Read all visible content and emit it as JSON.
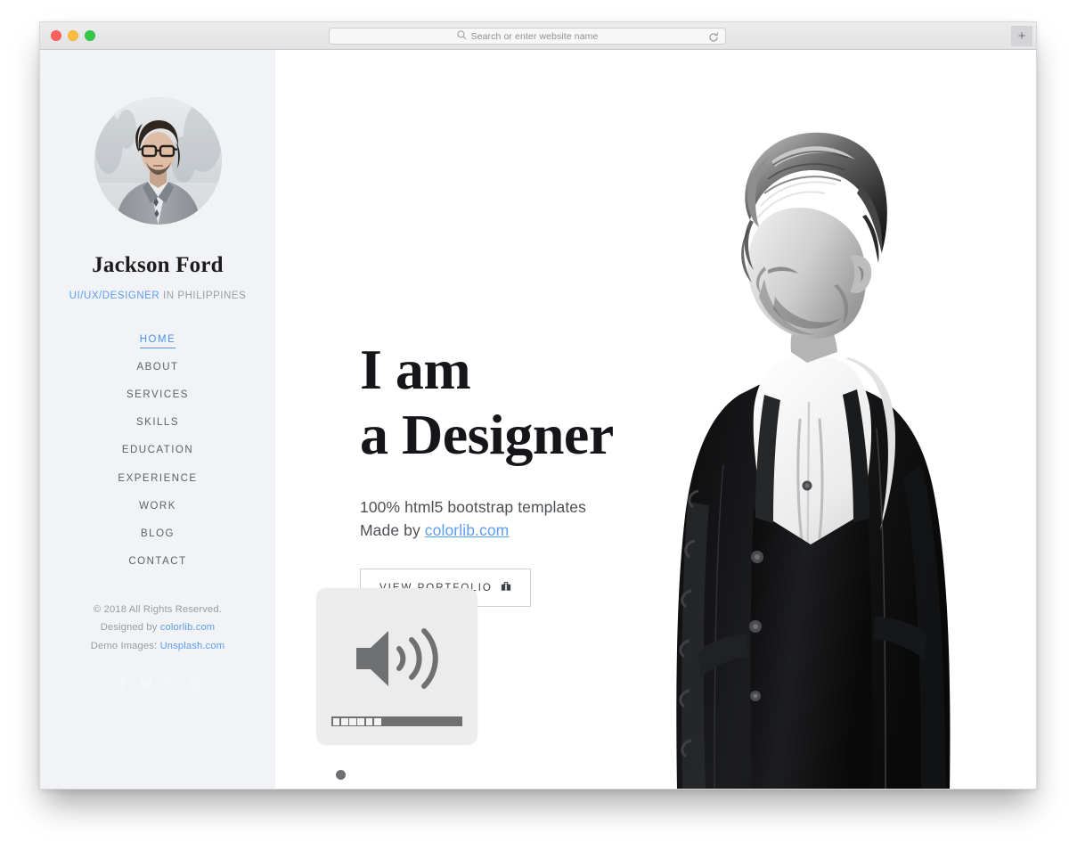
{
  "browser": {
    "traffic_lights": [
      "close",
      "minimize",
      "maximize"
    ],
    "omnibox": {
      "placeholder": "Search or enter website name",
      "value": "",
      "search_icon": "search-icon",
      "reload_icon": "reload-icon"
    },
    "new_tab_label": "+",
    "colors": {
      "titlebar_top": "#ececed",
      "titlebar_bottom": "#e3e3e5",
      "light_red": "#fc615d",
      "light_yellow": "#fdbc40",
      "light_green": "#34c749"
    }
  },
  "sidebar": {
    "avatar_alt": "profile-photo-man-with-glasses-in-gray-blazer",
    "name": "Jackson Ford",
    "role_accent": "UI/UX/DESIGNER",
    "role_rest": " IN PHILIPPINES",
    "nav": [
      {
        "label": "HOME",
        "active": true
      },
      {
        "label": "ABOUT",
        "active": false
      },
      {
        "label": "SERVICES",
        "active": false
      },
      {
        "label": "SKILLS",
        "active": false
      },
      {
        "label": "EDUCATION",
        "active": false
      },
      {
        "label": "EXPERIENCE",
        "active": false
      },
      {
        "label": "WORK",
        "active": false
      },
      {
        "label": "BLOG",
        "active": false
      },
      {
        "label": "CONTACT",
        "active": false
      }
    ],
    "footer": {
      "copyright": "© 2018 All Rights Reserved.",
      "designed_prefix": "Designed by ",
      "designed_link": "colorlib.com",
      "demo_prefix": "Demo Images: ",
      "demo_link": "Unsplash.com"
    },
    "socials": [
      {
        "name": "facebook-icon"
      },
      {
        "name": "twitter-icon"
      },
      {
        "name": "instagram-icon"
      },
      {
        "name": "linkedin-icon"
      }
    ],
    "colors": {
      "background": "#f1f3f7",
      "accent": "#5d9ded",
      "nav_text": "#5d6066"
    }
  },
  "hero": {
    "title_line1": "I am",
    "title_line2": "a Designer",
    "subtitle_line1": "100% html5 bootstrap templates",
    "subtitle_line2_prefix": "Made by ",
    "subtitle_line2_link": "colorlib.com",
    "button_label": "VIEW PORTFOLIO",
    "button_icon": "briefcase-icon",
    "photo_alt": "black-and-white-photo-of-man-in-dark-parka-and-white-hoodie-head-bowed"
  },
  "volume_osd": {
    "icon": "speaker-volume-high-icon",
    "segments_total": 16,
    "segments_filled": 6,
    "level_percent": 37,
    "colors": {
      "panel": "#ececec",
      "icon": "#6f7071",
      "bar_track": "#6f7071",
      "bar_segment": "#f4f4f4"
    }
  },
  "carousel": {
    "dots": [
      {
        "name": "carousel-dot-1",
        "style": "filled",
        "color": "#6d6f73"
      },
      {
        "name": "carousel-dot-2",
        "style": "ring",
        "color": "#1a8cff"
      }
    ]
  }
}
